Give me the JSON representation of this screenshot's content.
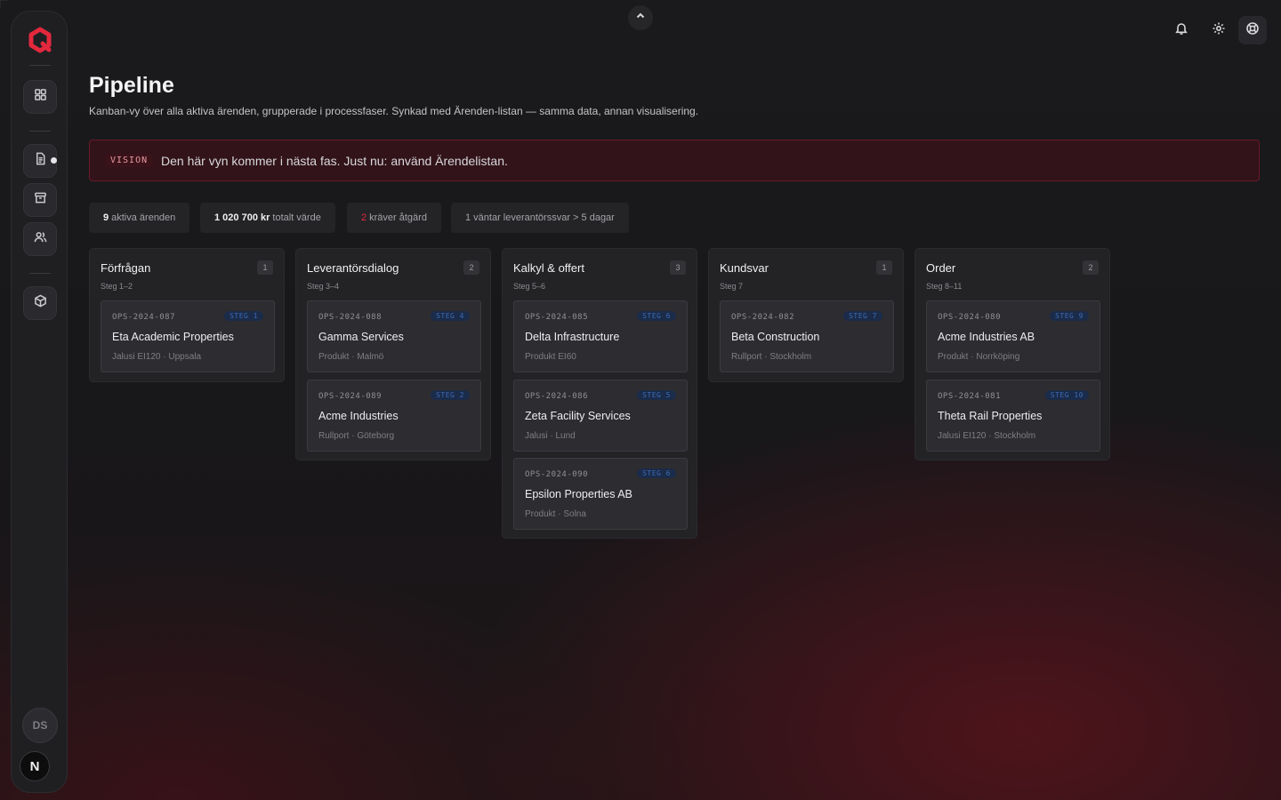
{
  "colors": {
    "accent": "#e3283d",
    "step_badge": "#3d6bb4",
    "banner_border": "#6a1a28"
  },
  "sidebar": {
    "logo_icon": "app-logo-icon",
    "items": [
      {
        "icon": "dashboard-icon"
      },
      {
        "icon": "document-icon",
        "has_notification": true
      },
      {
        "icon": "archive-icon"
      },
      {
        "icon": "users-icon"
      },
      {
        "icon": "package-icon"
      }
    ],
    "user_initials": "DS",
    "footer_badge": "N"
  },
  "topbar": {
    "collapse_icon": "chevron-up-icon",
    "icons": [
      "bell-icon",
      "gear-icon",
      "lifebuoy-icon"
    ]
  },
  "header": {
    "title": "Pipeline",
    "subtitle": "Kanban-vy över alla aktiva ärenden, grupperade i processfaser. Synkad med Ärenden-listan — samma data, annan visualisering."
  },
  "banner": {
    "tag": "VISION",
    "text": "Den här vyn kommer i nästa fas. Just nu: använd Ärendelistan."
  },
  "stats": {
    "active_value": "9",
    "active_label": "aktiva ärenden",
    "total_value": "1 020 700 kr",
    "total_label": "totalt värde",
    "action_value": "2",
    "action_label": "kräver åtgärd",
    "waiting_text": "1 väntar leverantörssvar > 5 dagar"
  },
  "columns": [
    {
      "title": "Förfrågan",
      "steps": "Steg 1–2",
      "count": "1",
      "cards": [
        {
          "id": "OPS-2024-087",
          "step": "STEG 1",
          "name": "Eta Academic Properties",
          "meta": "Jalusi EI120 · Uppsala"
        }
      ]
    },
    {
      "title": "Leverantörsdialog",
      "steps": "Steg 3–4",
      "count": "2",
      "cards": [
        {
          "id": "OPS-2024-088",
          "step": "STEG 4",
          "name": "Gamma Services",
          "meta": "Produkt · Malmö"
        },
        {
          "id": "OPS-2024-089",
          "step": "STEG 2",
          "name": "Acme Industries",
          "meta": "Rullport · Göteborg"
        }
      ]
    },
    {
      "title": "Kalkyl & offert",
      "steps": "Steg 5–6",
      "count": "3",
      "cards": [
        {
          "id": "OPS-2024-085",
          "step": "STEG 6",
          "name": "Delta Infrastructure",
          "meta": "Produkt EI60"
        },
        {
          "id": "OPS-2024-086",
          "step": "STEG 5",
          "name": "Zeta Facility Services",
          "meta": "Jalusi · Lund"
        },
        {
          "id": "OPS-2024-090",
          "step": "STEG 6",
          "name": "Epsilon Properties AB",
          "meta": "Produkt · Solna"
        }
      ]
    },
    {
      "title": "Kundsvar",
      "steps": "Steg 7",
      "count": "1",
      "cards": [
        {
          "id": "OPS-2024-082",
          "step": "STEG 7",
          "name": "Beta Construction",
          "meta": "Rullport · Stockholm"
        }
      ]
    },
    {
      "title": "Order",
      "steps": "Steg 8–11",
      "count": "2",
      "cards": [
        {
          "id": "OPS-2024-080",
          "step": "STEG 9",
          "name": "Acme Industries AB",
          "meta": "Produkt · Norrköping"
        },
        {
          "id": "OPS-2024-081",
          "step": "STEG 10",
          "name": "Theta Rail Properties",
          "meta": "Jalusi EI120 · Stockholm"
        }
      ]
    }
  ]
}
